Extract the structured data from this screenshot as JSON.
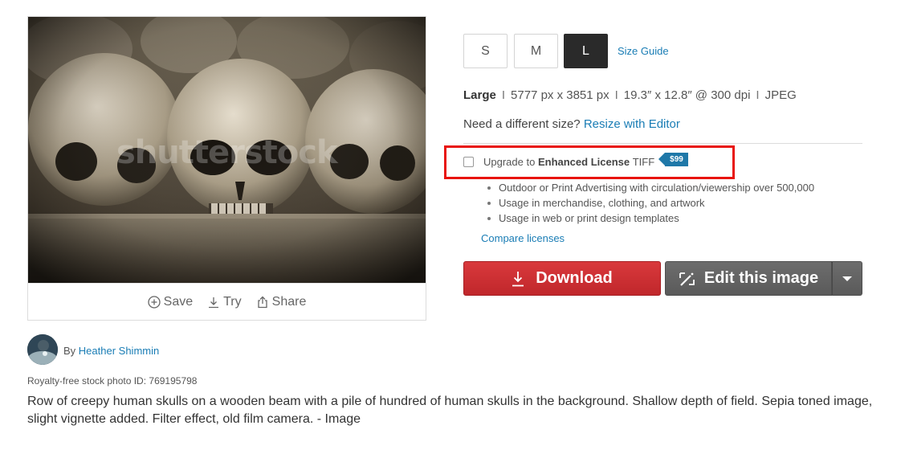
{
  "image_card": {
    "watermark": "shutterstock",
    "actions": {
      "save_label": "Save",
      "try_label": "Try",
      "share_label": "Share"
    }
  },
  "author": {
    "prefix": "By",
    "name": "Heather Shimmin"
  },
  "photo_id": "Royalty-free stock photo ID: 769195798",
  "description": "Row of creepy human skulls on a wooden beam with a pile of hundred of human skulls in the background. Shallow depth of field. Sepia toned image, slight vignette added. Filter effect, old film camera. - Image",
  "sizes": {
    "options": [
      "S",
      "M",
      "L"
    ],
    "selected": "L",
    "guide_label": "Size Guide"
  },
  "spec": {
    "size_name": "Large",
    "pixels": "5777 px x 3851 px",
    "inches": "19.3″ x 12.8″ @ 300 dpi",
    "format": "JPEG",
    "separator": "I"
  },
  "need_size": {
    "text": "Need a different size?",
    "link": "Resize with Editor"
  },
  "license": {
    "upgrade_prefix": "Upgrade to",
    "enhanced_label": "Enhanced License",
    "format": "TIFF",
    "price": "$99",
    "benefits": [
      "Outdoor or Print Advertising with circulation/viewership over 500,000",
      "Usage in merchandise, clothing, and artwork",
      "Usage in web or print design templates"
    ],
    "compare_label": "Compare licenses"
  },
  "buttons": {
    "download_label": "Download",
    "edit_label": "Edit this image"
  },
  "colors": {
    "accent_link": "#1a7db5",
    "download_red": "#c0272b",
    "highlight_red": "#e8140f",
    "price_blue": "#1f78a8",
    "selected_size": "#2a2a2a"
  },
  "icons": {
    "save": "plus-circle-icon",
    "try": "download-arrow-icon",
    "share": "share-icon",
    "download": "download-arrow-icon",
    "edit": "magic-wand-icon",
    "dropdown": "caret-down-icon"
  }
}
